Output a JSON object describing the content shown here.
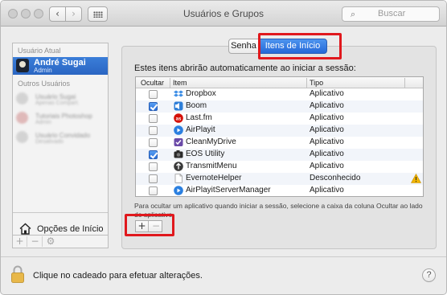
{
  "window": {
    "title": "Usuários e Grupos"
  },
  "toolbar": {
    "back": "‹",
    "forward": "›",
    "search_icon": "⌕",
    "search_placeholder": "Buscar"
  },
  "sidebar": {
    "current_header": "Usuário Atual",
    "current_user": {
      "name": "André Sugai",
      "role": "Admin"
    },
    "others_header": "Outros Usuários",
    "blurred_users": [
      {
        "line1": "Usuário Sugai",
        "line2": "Apenas Compart."
      },
      {
        "line1": "Tutoriais Photoshop",
        "line2": "Admin"
      },
      {
        "line1": "Usuário Convidado",
        "line2": "Desativado"
      }
    ],
    "login_options_label": "Opções de Início",
    "tools": {
      "add": "+",
      "remove": "−",
      "gear": "⚙"
    }
  },
  "tabs": {
    "password": "Senha",
    "login_items": "Itens de Início"
  },
  "panel": {
    "intro": "Estes itens abrirão automaticamente ao iniciar a sessão:",
    "columns": {
      "hide": "Ocultar",
      "item": "Item",
      "type": "Tipo"
    },
    "items": [
      {
        "name": "Dropbox",
        "type": "Aplicativo",
        "hidden": false,
        "icon": "dropbox-icon",
        "color": "#3d8ee6"
      },
      {
        "name": "Boom",
        "type": "Aplicativo",
        "hidden": true,
        "icon": "boom-icon",
        "color": "#2f7fd8"
      },
      {
        "name": "Last.fm",
        "type": "Aplicativo",
        "hidden": false,
        "icon": "lastfm-icon",
        "color": "#d51007"
      },
      {
        "name": "AirPlayit",
        "type": "Aplicativo",
        "hidden": false,
        "icon": "airplayit-icon",
        "color": "#2a7fe0"
      },
      {
        "name": "CleanMyDrive",
        "type": "Aplicativo",
        "hidden": false,
        "icon": "cleanmydrive-icon",
        "color": "#6a4aa8"
      },
      {
        "name": "EOS Utility",
        "type": "Aplicativo",
        "hidden": true,
        "icon": "eos-utility-icon",
        "color": "#2b2b2b"
      },
      {
        "name": "TransmitMenu",
        "type": "Aplicativo",
        "hidden": false,
        "icon": "transmitmenu-icon",
        "color": "#3a3a3a"
      },
      {
        "name": "EvernoteHelper",
        "type": "Desconhecido",
        "hidden": false,
        "icon": "evernotehelper-icon",
        "color": "#ffffff",
        "warning": true
      },
      {
        "name": "AirPlayitServerManager",
        "type": "Aplicativo",
        "hidden": false,
        "icon": "airplayitservermanager-icon",
        "color": "#2a7fe0"
      }
    ],
    "note": "Para ocultar um aplicativo quando iniciar a sessão, selecione a caixa da coluna Ocultar ao lado do aplicativo.",
    "add_label": "+",
    "remove_label": "−"
  },
  "footer": {
    "lock_label": "Clique no cadeado para efetuar alterações.",
    "help_label": "?"
  },
  "colors": {
    "accent": "#2a6fd8",
    "highlight": "#e0181d",
    "warning": "#f0b400"
  }
}
